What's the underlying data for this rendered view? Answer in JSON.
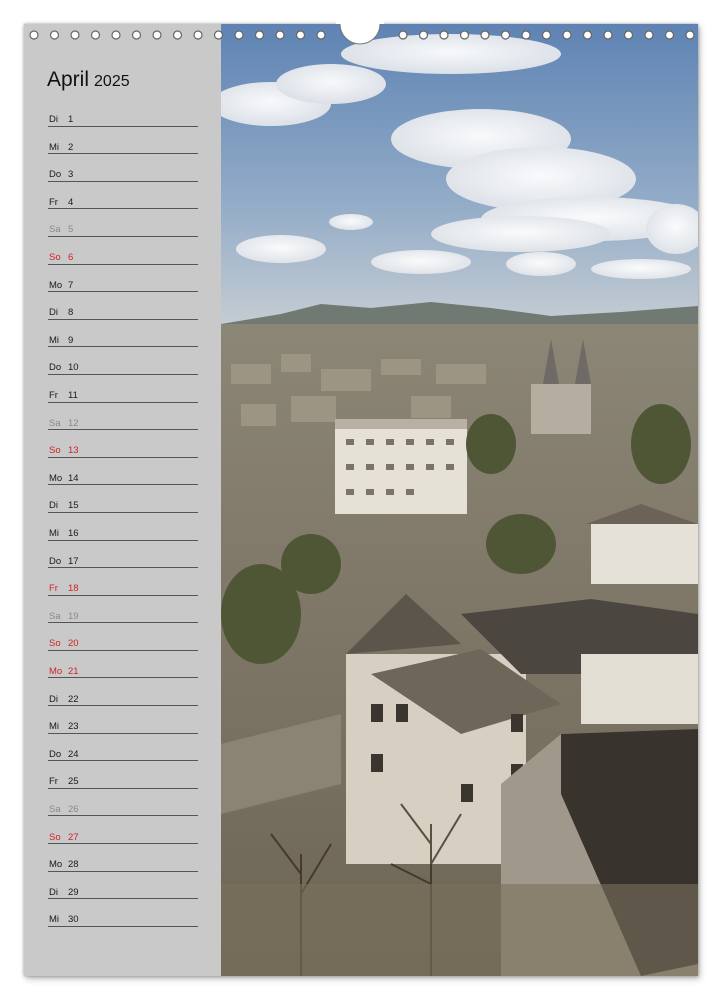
{
  "calendar": {
    "month": "April",
    "year": "2025",
    "days": [
      {
        "dow": "Di",
        "day": "1",
        "type": "weekday"
      },
      {
        "dow": "Mi",
        "day": "2",
        "type": "weekday"
      },
      {
        "dow": "Do",
        "day": "3",
        "type": "weekday"
      },
      {
        "dow": "Fr",
        "day": "4",
        "type": "weekday"
      },
      {
        "dow": "Sa",
        "day": "5",
        "type": "saturday"
      },
      {
        "dow": "So",
        "day": "6",
        "type": "red"
      },
      {
        "dow": "Mo",
        "day": "7",
        "type": "weekday"
      },
      {
        "dow": "Di",
        "day": "8",
        "type": "weekday"
      },
      {
        "dow": "Mi",
        "day": "9",
        "type": "weekday"
      },
      {
        "dow": "Do",
        "day": "10",
        "type": "weekday"
      },
      {
        "dow": "Fr",
        "day": "11",
        "type": "weekday"
      },
      {
        "dow": "Sa",
        "day": "12",
        "type": "saturday"
      },
      {
        "dow": "So",
        "day": "13",
        "type": "red"
      },
      {
        "dow": "Mo",
        "day": "14",
        "type": "weekday"
      },
      {
        "dow": "Di",
        "day": "15",
        "type": "weekday"
      },
      {
        "dow": "Mi",
        "day": "16",
        "type": "weekday"
      },
      {
        "dow": "Do",
        "day": "17",
        "type": "weekday"
      },
      {
        "dow": "Fr",
        "day": "18",
        "type": "red"
      },
      {
        "dow": "Sa",
        "day": "19",
        "type": "saturday"
      },
      {
        "dow": "So",
        "day": "20",
        "type": "red"
      },
      {
        "dow": "Mo",
        "day": "21",
        "type": "red"
      },
      {
        "dow": "Di",
        "day": "22",
        "type": "weekday"
      },
      {
        "dow": "Mi",
        "day": "23",
        "type": "weekday"
      },
      {
        "dow": "Do",
        "day": "24",
        "type": "weekday"
      },
      {
        "dow": "Fr",
        "day": "25",
        "type": "weekday"
      },
      {
        "dow": "Sa",
        "day": "26",
        "type": "saturday"
      },
      {
        "dow": "So",
        "day": "27",
        "type": "red"
      },
      {
        "dow": "Mo",
        "day": "28",
        "type": "weekday"
      },
      {
        "dow": "Di",
        "day": "29",
        "type": "weekday"
      },
      {
        "dow": "Mi",
        "day": "30",
        "type": "weekday"
      }
    ]
  },
  "colors": {
    "sidebar": "#c9c9c9",
    "text": "#1a1a1a",
    "saturday": "#8a8a8a",
    "sunday_holiday": "#d0232a",
    "rule_line": "#555555"
  },
  "photo": {
    "subject": "town-view-photo"
  }
}
